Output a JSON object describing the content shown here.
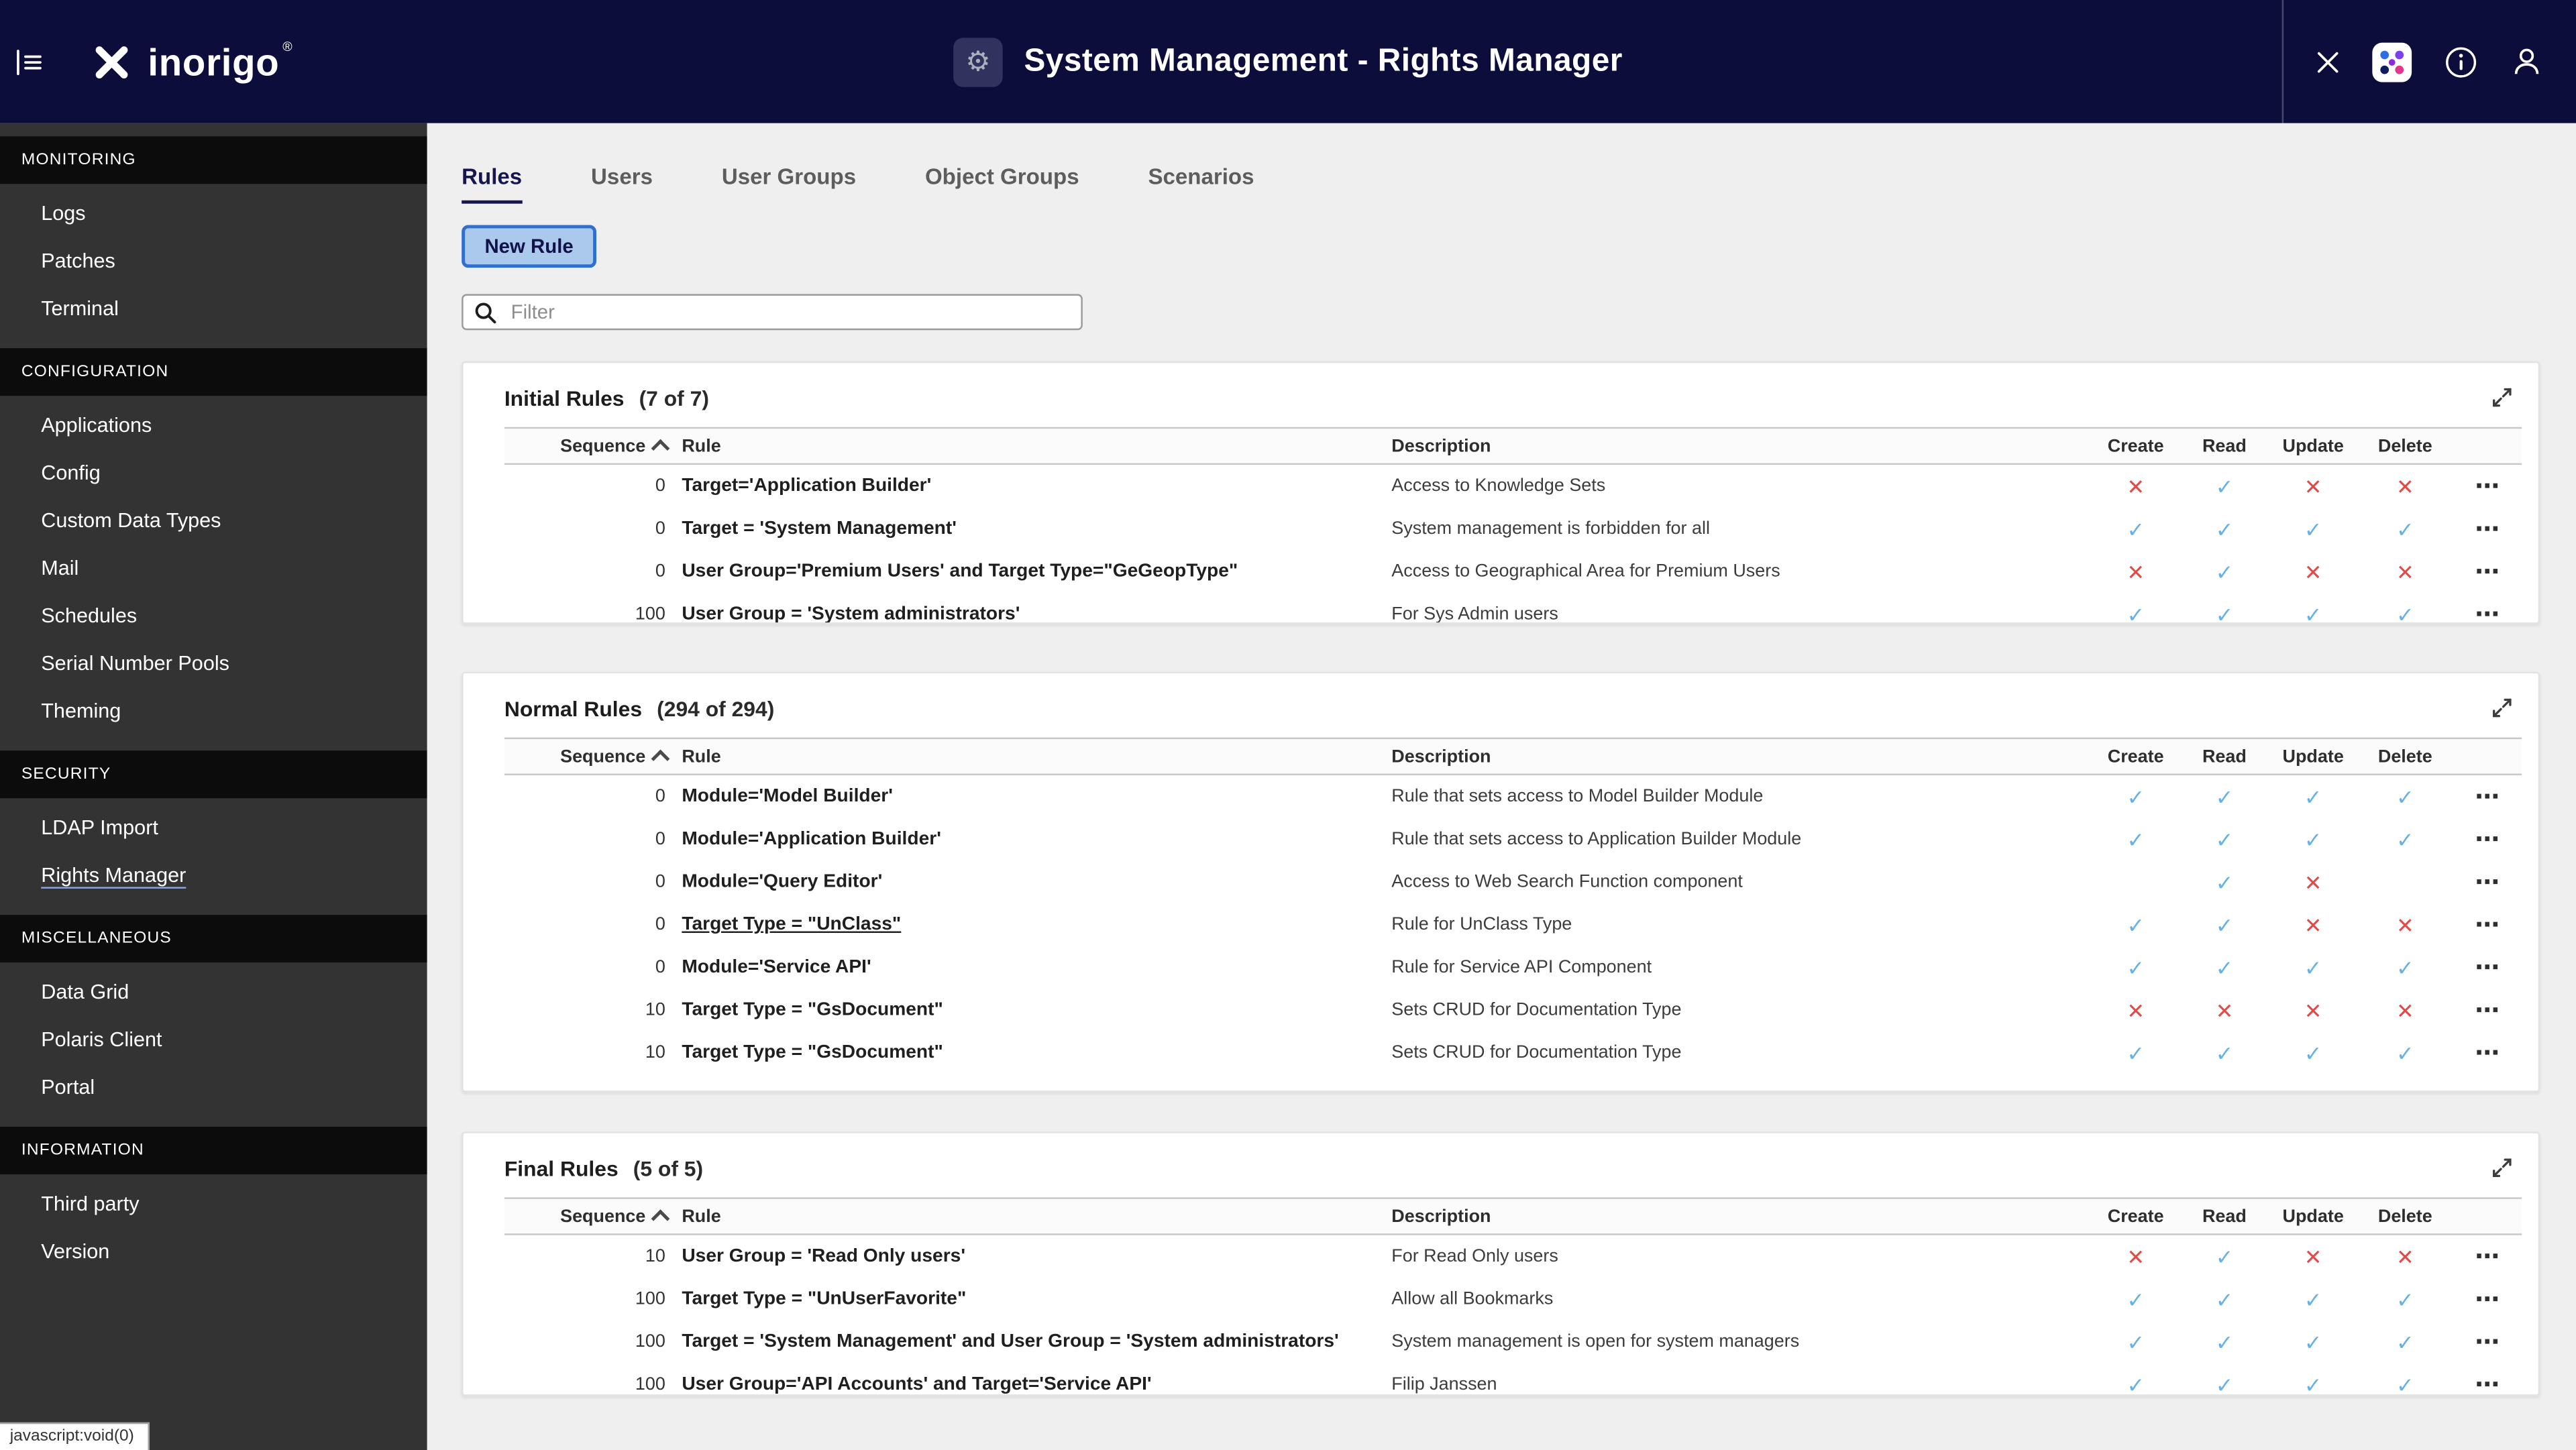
{
  "colors": {
    "brand": "#0d0d3c",
    "check": "#68b1e6",
    "cross": "#e04a47",
    "accent": "#2e6fd0"
  },
  "header": {
    "logo_text": "inorigo",
    "logo_reg": "®",
    "title": "System Management - Rights Manager"
  },
  "sidebar": {
    "sections": [
      {
        "label": "MONITORING",
        "items": [
          {
            "label": "Logs",
            "active": false
          },
          {
            "label": "Patches",
            "active": false
          },
          {
            "label": "Terminal",
            "active": false
          }
        ]
      },
      {
        "label": "CONFIGURATION",
        "items": [
          {
            "label": "Applications",
            "active": false
          },
          {
            "label": "Config",
            "active": false
          },
          {
            "label": "Custom Data Types",
            "active": false
          },
          {
            "label": "Mail",
            "active": false
          },
          {
            "label": "Schedules",
            "active": false
          },
          {
            "label": "Serial Number Pools",
            "active": false
          },
          {
            "label": "Theming",
            "active": false
          }
        ]
      },
      {
        "label": "SECURITY",
        "items": [
          {
            "label": "LDAP Import",
            "active": false
          },
          {
            "label": "Rights Manager",
            "active": true
          }
        ]
      },
      {
        "label": "MISCELLANEOUS",
        "items": [
          {
            "label": "Data Grid",
            "active": false
          },
          {
            "label": "Polaris Client",
            "active": false
          },
          {
            "label": "Portal",
            "active": false
          }
        ]
      },
      {
        "label": "INFORMATION",
        "items": [
          {
            "label": "Third party",
            "active": false
          },
          {
            "label": "Version",
            "active": false
          }
        ]
      }
    ]
  },
  "tabs": [
    {
      "label": "Rules",
      "active": true
    },
    {
      "label": "Users",
      "active": false
    },
    {
      "label": "User Groups",
      "active": false
    },
    {
      "label": "Object Groups",
      "active": false
    },
    {
      "label": "Scenarios",
      "active": false
    }
  ],
  "toolbar": {
    "new_rule_label": "New Rule",
    "filter_placeholder": "Filter"
  },
  "panels": [
    {
      "title": "Initial Rules",
      "count": "(7 of 7)",
      "columns": [
        "Sequence",
        "Rule",
        "Description",
        "Create",
        "Read",
        "Update",
        "Delete"
      ],
      "rows": [
        {
          "sequence": "0",
          "rule": "Target='Application Builder'",
          "underline": false,
          "description": "Access to Knowledge Sets",
          "marks": [
            "cross",
            "check",
            "cross",
            "cross"
          ]
        },
        {
          "sequence": "0",
          "rule": "Target = 'System Management'",
          "underline": false,
          "description": "System management is forbidden for all",
          "marks": [
            "check",
            "check",
            "check",
            "check"
          ]
        },
        {
          "sequence": "0",
          "rule": "User Group='Premium Users' and Target Type=\"GeGeopType\"",
          "underline": false,
          "description": "Access to Geographical Area for Premium Users",
          "marks": [
            "cross",
            "check",
            "cross",
            "cross"
          ]
        },
        {
          "sequence": "100",
          "rule": "User Group = 'System administrators'",
          "underline": false,
          "description": "For Sys Admin users",
          "marks": [
            "check",
            "check",
            "check",
            "check"
          ]
        }
      ]
    },
    {
      "title": "Normal Rules",
      "count": "(294 of 294)",
      "columns": [
        "Sequence",
        "Rule",
        "Description",
        "Create",
        "Read",
        "Update",
        "Delete"
      ],
      "rows": [
        {
          "sequence": "0",
          "rule": "Module='Model Builder'",
          "underline": false,
          "description": "Rule that sets access to Model Builder Module",
          "marks": [
            "check",
            "check",
            "check",
            "check"
          ]
        },
        {
          "sequence": "0",
          "rule": "Module='Application Builder'",
          "underline": false,
          "description": "Rule that sets access to Application Builder Module",
          "marks": [
            "check",
            "check",
            "check",
            "check"
          ]
        },
        {
          "sequence": "0",
          "rule": "Module='Query Editor'",
          "underline": false,
          "description": "Access to Web Search Function component",
          "marks": [
            "",
            "check",
            "cross",
            ""
          ]
        },
        {
          "sequence": "0",
          "rule": "Target Type = \"UnClass\"",
          "underline": true,
          "description": "Rule for UnClass Type",
          "marks": [
            "check",
            "check",
            "cross",
            "cross"
          ]
        },
        {
          "sequence": "0",
          "rule": "Module='Service API'",
          "underline": false,
          "description": "Rule for Service API Component",
          "marks": [
            "check",
            "check",
            "check",
            "check"
          ]
        },
        {
          "sequence": "10",
          "rule": "Target Type = \"GsDocument\"",
          "underline": false,
          "description": "Sets CRUD for Documentation Type",
          "marks": [
            "cross",
            "cross",
            "cross",
            "cross"
          ]
        },
        {
          "sequence": "10",
          "rule": "Target Type = \"GsDocument\"",
          "underline": false,
          "description": "Sets CRUD for Documentation Type",
          "marks": [
            "check",
            "check",
            "check",
            "check"
          ]
        }
      ]
    },
    {
      "title": "Final Rules",
      "count": "(5 of 5)",
      "columns": [
        "Sequence",
        "Rule",
        "Description",
        "Create",
        "Read",
        "Update",
        "Delete"
      ],
      "rows": [
        {
          "sequence": "10",
          "rule": "User Group = 'Read Only users'",
          "underline": false,
          "description": "For Read Only users",
          "marks": [
            "cross",
            "check",
            "cross",
            "cross"
          ]
        },
        {
          "sequence": "100",
          "rule": "Target Type = \"UnUserFavorite\"",
          "underline": false,
          "description": "Allow all Bookmarks",
          "marks": [
            "check",
            "check",
            "check",
            "check"
          ]
        },
        {
          "sequence": "100",
          "rule": "Target = 'System Management' and User Group = 'System administrators'",
          "underline": false,
          "description": "System management is open for system managers",
          "marks": [
            "check",
            "check",
            "check",
            "check"
          ]
        },
        {
          "sequence": "100",
          "rule": "User Group='API Accounts' and Target='Service API'",
          "underline": false,
          "description": "Filip Janssen",
          "marks": [
            "check",
            "check",
            "check",
            "check"
          ]
        }
      ]
    }
  ],
  "status_bar": "javascript:void(0)"
}
